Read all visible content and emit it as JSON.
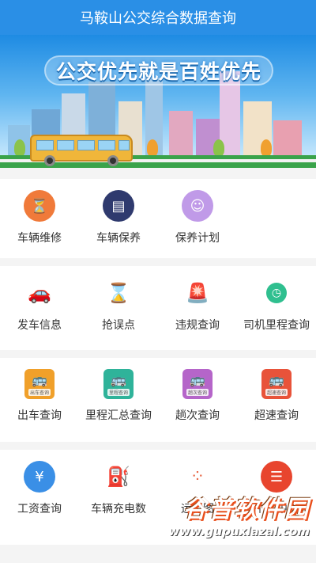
{
  "header": {
    "title": "马鞍山公交综合数据查询"
  },
  "banner": {
    "slogan": "公交优先就是百姓优先"
  },
  "sections": [
    {
      "items": [
        {
          "label": "车辆维修",
          "icon": "hourglass-doc-icon",
          "color": "#f07a3a"
        },
        {
          "label": "车辆保养",
          "icon": "newspaper-icon",
          "color": "#2f3a6e"
        },
        {
          "label": "保养计划",
          "icon": "person-plan-icon",
          "color": "#c09ae8"
        }
      ]
    },
    {
      "items": [
        {
          "label": "发车信息",
          "icon": "car-icon",
          "color": "#f2b21e"
        },
        {
          "label": "抢误点",
          "icon": "hourglass-icon",
          "color": "#e8573a"
        },
        {
          "label": "违规查询",
          "icon": "alarm-light-icon",
          "color": "#2f8fe6"
        },
        {
          "label": "司机里程查询",
          "icon": "clock-icon",
          "color": "#2fbf8f"
        }
      ]
    },
    {
      "items": [
        {
          "label": "出车查询",
          "icon": "bus-orange-icon",
          "color": "#f0a02a",
          "tag": "出车查询"
        },
        {
          "label": "里程汇总查询",
          "icon": "bus-teal-icon",
          "color": "#2fb39a",
          "tag": "里程查询"
        },
        {
          "label": "趟次查询",
          "icon": "bus-purple-icon",
          "color": "#b565c9",
          "tag": "趟次查询"
        },
        {
          "label": "超速查询",
          "icon": "bus-red-icon",
          "color": "#e8533a",
          "tag": "超速查询"
        }
      ]
    },
    {
      "items": [
        {
          "label": "工资查询",
          "icon": "money-icon",
          "color": "#3a8fe6"
        },
        {
          "label": "车辆充电数",
          "icon": "charger-icon",
          "color": "#2fbf9a"
        },
        {
          "label": "运行图",
          "icon": "dots-chart-icon",
          "color": "#e86a4a"
        },
        {
          "label": "个人中心",
          "icon": "profile-card-icon",
          "color": "#e8452e"
        }
      ]
    }
  ],
  "watermark": {
    "brand": "谷普软件园",
    "url": "www.gupuxlazal.com"
  }
}
